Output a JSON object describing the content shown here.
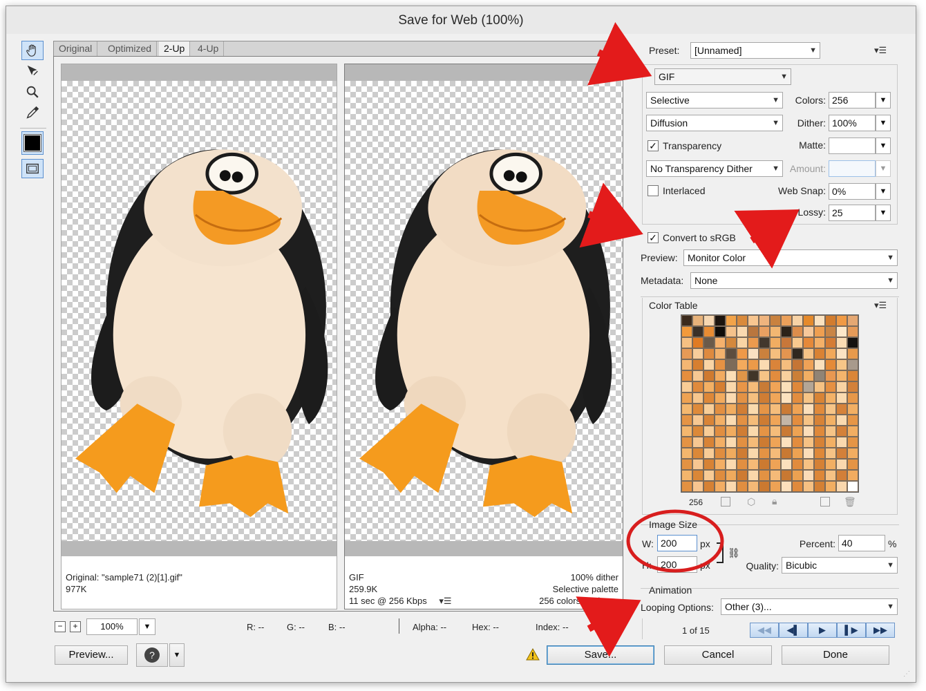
{
  "window": {
    "title": "Save for Web (100%)"
  },
  "tools": [
    {
      "name": "hand-tool",
      "icon": "hand-icon",
      "active": true
    },
    {
      "name": "slice-select-tool",
      "icon": "slice-select-icon"
    },
    {
      "name": "zoom-tool",
      "icon": "zoom-icon"
    },
    {
      "name": "eyedropper-tool",
      "icon": "eyedropper-icon"
    },
    {
      "name": "eyedropper-color",
      "icon": "color-swatch-icon",
      "color": "#000000"
    },
    {
      "name": "toggle-slices-visibility",
      "icon": "slices-visibility-icon"
    }
  ],
  "tabs": [
    {
      "label": "Original"
    },
    {
      "label": "Optimized"
    },
    {
      "label": "2-Up",
      "active": true
    },
    {
      "label": "4-Up"
    }
  ],
  "original_panel": {
    "line1": "Original: \"sample71 (2)[1].gif\"",
    "line2": "977K"
  },
  "optimized_panel": {
    "left_line1": "GIF",
    "left_line2": "259.9K",
    "left_line3": "11 sec @ 256 Kbps",
    "right_line1": "100% dither",
    "right_line2": "Selective palette",
    "right_line3": "256 colors, 25 lossy"
  },
  "settings": {
    "preset_label": "Preset:",
    "preset_value": "[Unnamed]",
    "format": "GIF",
    "reduction": "Selective",
    "colors_label": "Colors:",
    "colors_value": "256",
    "dither_algorithm": "Diffusion",
    "dither_label": "Dither:",
    "dither_value": "100%",
    "transparency_label": "Transparency",
    "transparency_checked": true,
    "matte_label": "Matte:",
    "matte_value": "",
    "transparency_dither": "No Transparency Dither",
    "amount_label": "Amount:",
    "amount_value": "",
    "interlaced_label": "Interlaced",
    "interlaced_checked": false,
    "websnap_label": "Web Snap:",
    "websnap_value": "0%",
    "lossy_label": "Lossy:",
    "lossy_value": "25",
    "convert_label": "Convert to sRGB",
    "convert_checked": true,
    "preview_label": "Preview:",
    "preview_value": "Monitor Color",
    "metadata_label": "Metadata:",
    "metadata_value": "None"
  },
  "color_table": {
    "title": "Color Table",
    "count": "256",
    "colors": [
      "#3b2a1c",
      "#e7b27a",
      "#f6d7b2",
      "#1c140e",
      "#f2a349",
      "#d98a3c",
      "#f8c690",
      "#efb47e",
      "#c9823f",
      "#eba05a",
      "#f7d3a7",
      "#e58a2b",
      "#fbe2c0",
      "#d27c2e",
      "#f09a45",
      "#e5a873",
      "#f29a3b",
      "#3a3028",
      "#e88c34",
      "#0f0c09",
      "#f5c28b",
      "#fad9b0",
      "#b9763e",
      "#e9a062",
      "#f3b772",
      "#2b2219",
      "#dc8d4c",
      "#f6c89b",
      "#ef9f51",
      "#c98545",
      "#fde8ca",
      "#e69b59",
      "#f6c082",
      "#e07b23",
      "#6a5a4a",
      "#f5b16d",
      "#d4883c",
      "#fad4a4",
      "#eb9a4e",
      "#42372d",
      "#f1ad62",
      "#c8773a",
      "#f8c98f",
      "#e5893a",
      "#f4b068",
      "#d47c35",
      "#fbdcb3",
      "#151210",
      "#e69a56",
      "#f7cd9b",
      "#de8a3f",
      "#f3b26d",
      "#5c4d3f",
      "#ee9948",
      "#fae1c2",
      "#cb813d",
      "#f5be7e",
      "#e49550",
      "#2f271f",
      "#f6c387",
      "#d98234",
      "#f1a85a",
      "#fce3c3",
      "#e89a4c",
      "#f4b673",
      "#d77f30",
      "#f9d4a5",
      "#e69244",
      "#7d6b59",
      "#f3aa5d",
      "#ec9a49",
      "#fbdbb1",
      "#da843a",
      "#f5bd7e",
      "#c57535",
      "#efa257",
      "#fae0bd",
      "#e48a38",
      "#f6c688",
      "#a89a8c",
      "#e58e3e",
      "#f7c993",
      "#cf7a2f",
      "#f2ab60",
      "#fbdeb6",
      "#e09548",
      "#403528",
      "#f6c386",
      "#e28c3e",
      "#f8d09d",
      "#cc7f37",
      "#f1ae63",
      "#918475",
      "#e99851",
      "#f4b46c",
      "#db8638",
      "#f8cc96",
      "#e08a3c",
      "#f3b064",
      "#d67f32",
      "#fad8ab",
      "#e89547",
      "#f5bb79",
      "#c87b36",
      "#f0a457",
      "#fbe0ba",
      "#df883a",
      "#b4a696",
      "#f6c283",
      "#e59042",
      "#f9d3a2",
      "#d3813a",
      "#eea252",
      "#f7c78e",
      "#dd8738",
      "#f2ab5e",
      "#fbdab0",
      "#e39245",
      "#f5bf7f",
      "#cf7d34",
      "#f0a659",
      "#fce2bf",
      "#e28d3f",
      "#f6c486",
      "#d88436",
      "#f3b267",
      "#fadbb0",
      "#e79849",
      "#f4b86f",
      "#de8a3a",
      "#f8ce99",
      "#e28f41",
      "#f1ad60",
      "#d17e35",
      "#fadaad",
      "#e69546",
      "#f5bd7b",
      "#cb7b35",
      "#efa354",
      "#fbdfbb",
      "#e08a3b",
      "#f6c588",
      "#d5823a",
      "#f2af63",
      "#e59445",
      "#f7c893",
      "#d98437",
      "#f3b066",
      "#fbdcb2",
      "#e39143",
      "#f5bc79",
      "#ce7c33",
      "#f0a558",
      "#c4b6a6",
      "#e38d3e",
      "#f6c385",
      "#d78337",
      "#f3b165",
      "#fadab0",
      "#e69647",
      "#f4b76e",
      "#dc8939",
      "#f8cd98",
      "#e18e40",
      "#f1ac5f",
      "#d07d34",
      "#fad9ac",
      "#e59445",
      "#f5bc7a",
      "#ca7a34",
      "#eea353",
      "#fbdeba",
      "#df893a",
      "#f6c487",
      "#d4813a",
      "#f2ae62",
      "#e49344",
      "#f7c792",
      "#d88336",
      "#f3af65",
      "#fbdbb1",
      "#e29042",
      "#f5bb78",
      "#cd7b32",
      "#efa457",
      "#fce1be",
      "#e28c3e",
      "#f6c284",
      "#d68236",
      "#f3b064",
      "#fad9af",
      "#e59546",
      "#f4b66d",
      "#db8838",
      "#f8cc97",
      "#e08d3f",
      "#f0ab5e",
      "#cf7c33",
      "#fad8ab",
      "#e49344",
      "#f5bb79",
      "#c97933",
      "#eda252",
      "#fbddb9",
      "#de8839",
      "#f6c386",
      "#d3803a",
      "#f2ad61",
      "#e39243",
      "#f7c691",
      "#d78235",
      "#f3ae64",
      "#fbdab0",
      "#e18f41",
      "#f5ba77",
      "#cc7a31",
      "#eea356",
      "#fce0bd",
      "#e18b3d",
      "#f6c183",
      "#d58135",
      "#f2af63",
      "#fad8ae",
      "#e49445",
      "#f3b56c",
      "#da8737",
      "#f8cb96",
      "#df8c3e",
      "#f0aa5d",
      "#ce7b32",
      "#fad7aa",
      "#e39243",
      "#f5ba78",
      "#c87832",
      "#eca151",
      "#fbdcb8",
      "#dd8738",
      "#f6c285",
      "#d27f39",
      "#f2ac60",
      "#e29142",
      "#f7c590",
      "#d68134",
      "#f3ad63",
      "#fbd9af",
      "#e08e40",
      "#f5b976",
      "#cb7930",
      "#eda255",
      "#fcdfbc",
      "#e08a3c",
      "#f6c082",
      "#d48034",
      "#f2ae62",
      "#fad7ad",
      "#ffffff"
    ],
    "icons": [
      "map-to-transparent-icon",
      "web-shift-icon",
      "lock-color-icon",
      "new-color-icon",
      "trash-icon"
    ]
  },
  "image_size": {
    "title": "Image Size",
    "w_label": "W:",
    "w_value": "200",
    "h_label": "H:",
    "h_value": "200",
    "unit": "px",
    "percent_label": "Percent:",
    "percent_value": "40",
    "percent_unit": "%",
    "quality_label": "Quality:",
    "quality_value": "Bicubic"
  },
  "animation": {
    "title": "Animation",
    "looping_label": "Looping Options:",
    "looping_value": "Other (3)...",
    "frame_counter": "1 of 15"
  },
  "statusbar": {
    "zoom_value": "100%",
    "r": "R: --",
    "g": "G: --",
    "b": "B: --",
    "alpha": "Alpha: --",
    "hex": "Hex: --",
    "index": "Index: --"
  },
  "buttons": {
    "preview": "Preview...",
    "save": "Save...",
    "cancel": "Cancel",
    "done": "Done"
  },
  "colors": {
    "annotation_arrow": "#e31b1b",
    "annotation_circle": "#d81e1e",
    "penguin_body": "#f6e4cf",
    "penguin_black": "#1e1e1e",
    "penguin_orange": "#f49a24"
  }
}
